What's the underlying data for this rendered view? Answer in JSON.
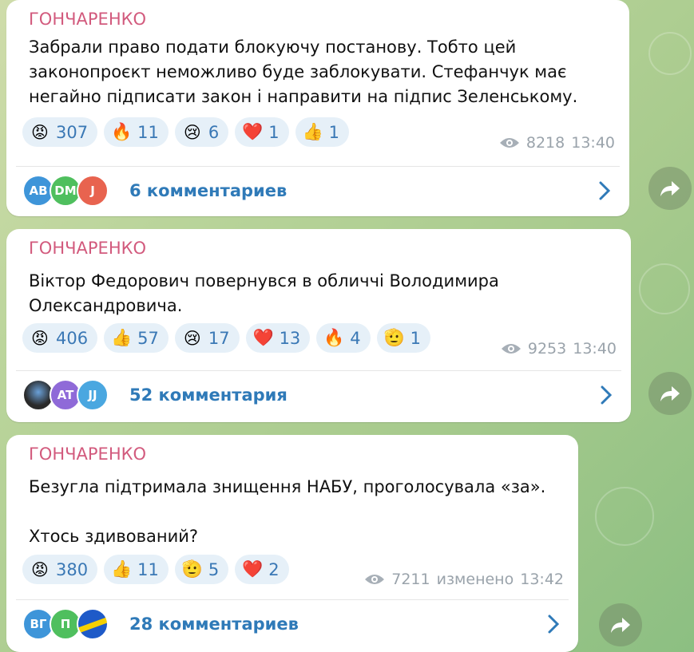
{
  "posts": [
    {
      "sender": "ГОНЧАРЕНКО",
      "text": "Забрали право подати блокуючу постанову. Тобто цей законопроєкт неможливо буде заблокувати. Стефанчук має негайно підписати закон і направити на підпис Зеленському.",
      "reactions": [
        {
          "emoji": "😡",
          "count": "307"
        },
        {
          "emoji": "🔥",
          "count": "11"
        },
        {
          "emoji": "😢",
          "count": "6"
        },
        {
          "emoji": "❤️",
          "count": "1"
        },
        {
          "emoji": "👍",
          "count": "1"
        }
      ],
      "views": "8218",
      "edited": "",
      "time": "13:40",
      "avatars": [
        "AB",
        "DM",
        "J"
      ],
      "comments": "6 комментариев"
    },
    {
      "sender": "ГОНЧАРЕНКО",
      "text": "Віктор Федорович повернувся в обличчі Володимира Олександровича.",
      "reactions": [
        {
          "emoji": "😡",
          "count": "406"
        },
        {
          "emoji": "👍",
          "count": "57"
        },
        {
          "emoji": "😢",
          "count": "17"
        },
        {
          "emoji": "❤️",
          "count": "13"
        },
        {
          "emoji": "🔥",
          "count": "4"
        },
        {
          "emoji": "🫡",
          "count": "1"
        }
      ],
      "views": "9253",
      "edited": "",
      "time": "13:40",
      "avatars": [
        "",
        "AT",
        "JJ"
      ],
      "comments": "52 комментария"
    },
    {
      "sender": "ГОНЧАРЕНКО",
      "text": "Безугла підтримала знищення НАБУ, проголосувала «за».\n\nХтось здивований?",
      "reactions": [
        {
          "emoji": "😡",
          "count": "380"
        },
        {
          "emoji": "👍",
          "count": "11"
        },
        {
          "emoji": "🫡",
          "count": "5"
        },
        {
          "emoji": "❤️",
          "count": "2"
        }
      ],
      "views": "7211",
      "edited": "изменено",
      "time": "13:42",
      "avatars": [
        "ВГ",
        "П",
        ""
      ],
      "comments": "28 комментариев"
    }
  ],
  "icons": {
    "eye": "eye-icon",
    "chevron": "chevron-right-icon",
    "share": "share-arrow-icon"
  },
  "colors": {
    "sender": "#d25a7d",
    "link": "#2f7ab8",
    "reaction_bg": "#e6f0f8",
    "avatar_colors": [
      "#3e95d9",
      "#4fbf5e",
      "#e8634f",
      "#2a2a2a",
      "#8f6ad8",
      "#4aa7e0",
      "#3e95d9",
      "#4fbf5e",
      "#1e5ac8"
    ]
  }
}
